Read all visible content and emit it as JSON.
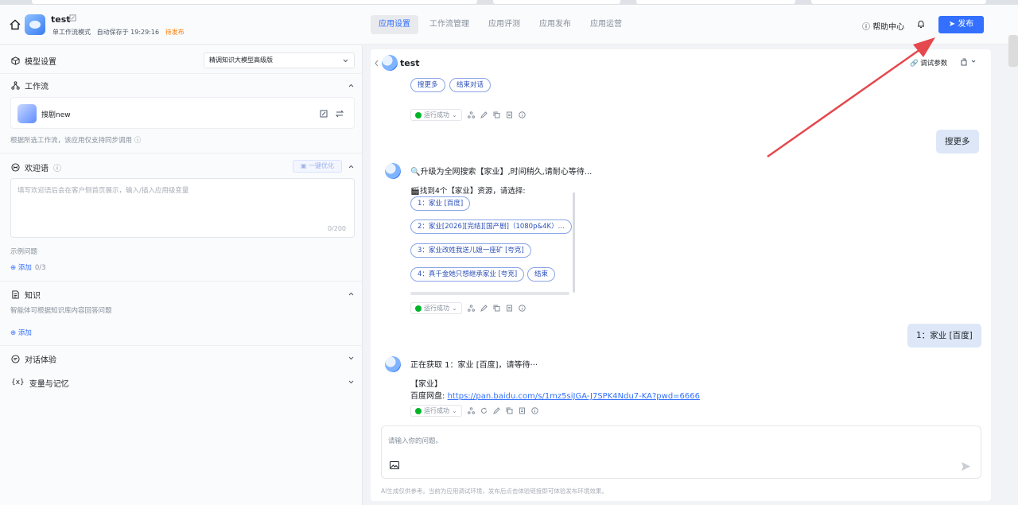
{
  "header": {
    "app_name": "test",
    "meta_mode": "单工作流模式",
    "meta_saved": "自动保存于 19:29:16",
    "meta_status": "待发布",
    "tabs": [
      "应用设置",
      "工作流管理",
      "应用评测",
      "应用发布",
      "应用运营"
    ],
    "active_tab": "应用设置",
    "help_label": "帮助中心",
    "publish_label": "发布"
  },
  "left": {
    "model": {
      "title": "模型设置",
      "selected": "精调知识大模型高级版"
    },
    "workflow": {
      "title": "工作流",
      "item_name": "搜剧new",
      "hint": "根据所选工作流，该应用仅支持同步调用"
    },
    "welcome": {
      "title": "欢迎语",
      "optimize_label": "一键优化",
      "placeholder": "填写欢迎语后会在客户侧首页展示，输入/插入应用级变量",
      "count": "0/200",
      "examples_label": "示例问题",
      "add_label": "添加",
      "add_count": "0/3"
    },
    "knowledge": {
      "title": "知识",
      "hint": "智能体可根据知识库内容回答问题",
      "add_label": "添加"
    },
    "dialog": {
      "title": "对话体验"
    },
    "variables": {
      "title": "变量与记忆"
    }
  },
  "chat": {
    "title": "test",
    "debug_params": "调试参数",
    "top_pills": [
      "搜更多",
      "结束对话"
    ],
    "status_label": "运行成功",
    "user_msg_1": "搜更多",
    "bot_msg_1_line1": "🔍升级为全网搜索【家业】,时间稍久,请耐心等待...",
    "bot_msg_1_line2": "🎬找到4个【家业】资源，请选择:",
    "options": [
      "1：家业 [百度]",
      "2：家业[2026][完结][国产剧]（1080p&4K）...",
      "3：家业改姓我送儿媳一座矿 [夸克]",
      "4：真千金她只想继承家业 [夸克]"
    ],
    "end_pill": "结束",
    "user_msg_2": "1：家业 [百度]",
    "bot_msg_2_line1": "正在获取 1：家业 [百度]，请等待···",
    "bot_msg_2_line2": "【家业】",
    "bot_msg_2_link_prefix": "百度网盘: ",
    "bot_msg_2_link": "https://pan.baidu.com/s/1mz5siJGA-J7SPK4Ndu7-KA?pwd=6666",
    "input_placeholder": "请输入你的问题。",
    "disclaimer": "AI生成仅供参考。当前为应用调试环境，发布后点击体验链接即可体验发布环境效果。"
  },
  "colors": {
    "accent": "#3370ff",
    "success": "#00b42a",
    "pending": "#ff7d00",
    "annotation_arrow": "#e5484d"
  }
}
